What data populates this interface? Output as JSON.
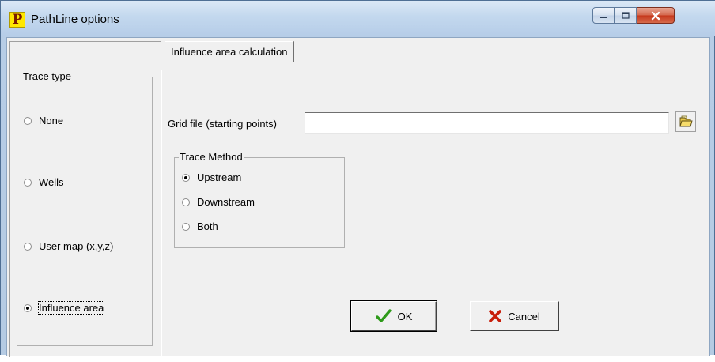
{
  "window": {
    "title": "PathLine options",
    "icon_letter": "P"
  },
  "trace_type": {
    "legend": "Trace type",
    "options": [
      {
        "label": "None",
        "checked": false
      },
      {
        "label": "Wells",
        "checked": false
      },
      {
        "label": "User map (x,y,z)",
        "checked": false
      },
      {
        "label": "Influence area",
        "checked": true
      }
    ]
  },
  "tabs": [
    {
      "label": "Influence area calculation",
      "active": true
    }
  ],
  "grid_file": {
    "label": "Grid file (starting points)",
    "value": ""
  },
  "trace_method": {
    "legend": "Trace Method",
    "options": [
      {
        "label": "Upstream",
        "checked": true
      },
      {
        "label": "Downstream",
        "checked": false
      },
      {
        "label": "Both",
        "checked": false
      }
    ]
  },
  "buttons": {
    "ok": "OK",
    "cancel": "Cancel"
  },
  "colors": {
    "ok_check": "#2e9a1a",
    "cancel_x": "#c81e0a",
    "icon_yellow": "#ffe800"
  },
  "icons": {
    "app": "pathline-app-icon",
    "browse": "open-folder-icon",
    "ok": "checkmark-icon",
    "cancel": "red-x-icon"
  }
}
